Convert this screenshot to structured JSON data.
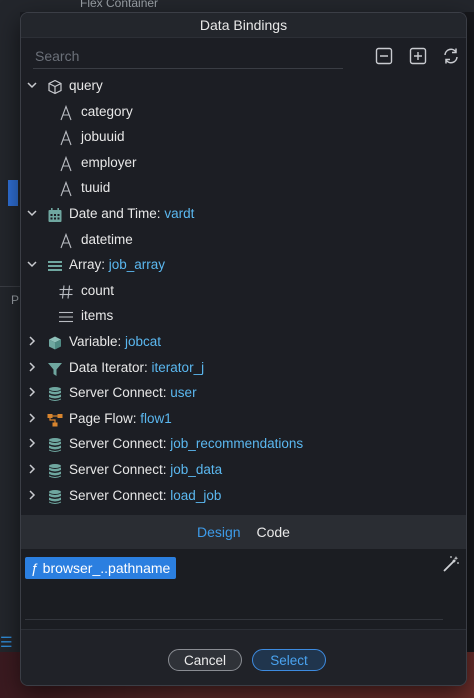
{
  "background": {
    "top_item": "Flex Container",
    "left_letter": "P"
  },
  "dialog": {
    "title": "Data Bindings",
    "search_placeholder": "Search",
    "tree": [
      {
        "key": "query",
        "val": "",
        "level": 0,
        "chevron": "down",
        "icon": "cube-icon"
      },
      {
        "key": "category",
        "val": "",
        "level": 1,
        "chevron": "",
        "icon": "text-type-icon"
      },
      {
        "key": "jobuuid",
        "val": "",
        "level": 1,
        "chevron": "",
        "icon": "text-type-icon"
      },
      {
        "key": "employer",
        "val": "",
        "level": 1,
        "chevron": "",
        "icon": "text-type-icon"
      },
      {
        "key": "tuuid",
        "val": "",
        "level": 1,
        "chevron": "",
        "icon": "text-type-icon"
      },
      {
        "key": "Date and Time: ",
        "val": "vardt",
        "level": 0,
        "chevron": "down",
        "icon": "calendar-icon"
      },
      {
        "key": "datetime",
        "val": "",
        "level": 1,
        "chevron": "",
        "icon": "text-type-icon"
      },
      {
        "key": "Array: ",
        "val": "job_array",
        "level": 0,
        "chevron": "down",
        "icon": "array-icon"
      },
      {
        "key": "count",
        "val": "",
        "level": 1,
        "chevron": "",
        "icon": "hash-icon"
      },
      {
        "key": "items",
        "val": "",
        "level": 1,
        "chevron": "",
        "icon": "list-icon"
      },
      {
        "key": "Variable: ",
        "val": "jobcat",
        "level": 0,
        "chevron": "right",
        "icon": "cube-solid-icon"
      },
      {
        "key": "Data Iterator: ",
        "val": "iterator_j",
        "level": 0,
        "chevron": "right",
        "icon": "funnel-icon"
      },
      {
        "key": "Server Connect: ",
        "val": "user",
        "level": 0,
        "chevron": "right",
        "icon": "database-icon"
      },
      {
        "key": "Page Flow: ",
        "val": "flow1",
        "level": 0,
        "chevron": "right",
        "icon": "flow-icon"
      },
      {
        "key": "Server Connect: ",
        "val": "job_recommendations",
        "level": 0,
        "chevron": "right",
        "icon": "database-icon"
      },
      {
        "key": "Server Connect: ",
        "val": "job_data",
        "level": 0,
        "chevron": "right",
        "icon": "database-icon"
      },
      {
        "key": "Server Connect: ",
        "val": "load_job",
        "level": 0,
        "chevron": "right",
        "icon": "database-icon"
      },
      {
        "key": "",
        "val": "",
        "level": 0,
        "chevron": "right",
        "icon": "database-icon"
      }
    ],
    "tabs": {
      "design": "Design",
      "code": "Code"
    },
    "expression": "ƒ browser_..pathname",
    "buttons": {
      "cancel": "Cancel",
      "select": "Select"
    },
    "colors": {
      "accent": "#3d9be9",
      "icon_teal": "#6fa7a0",
      "value_blue": "#5bb8f0",
      "flow_orange": "#d9852e"
    }
  }
}
